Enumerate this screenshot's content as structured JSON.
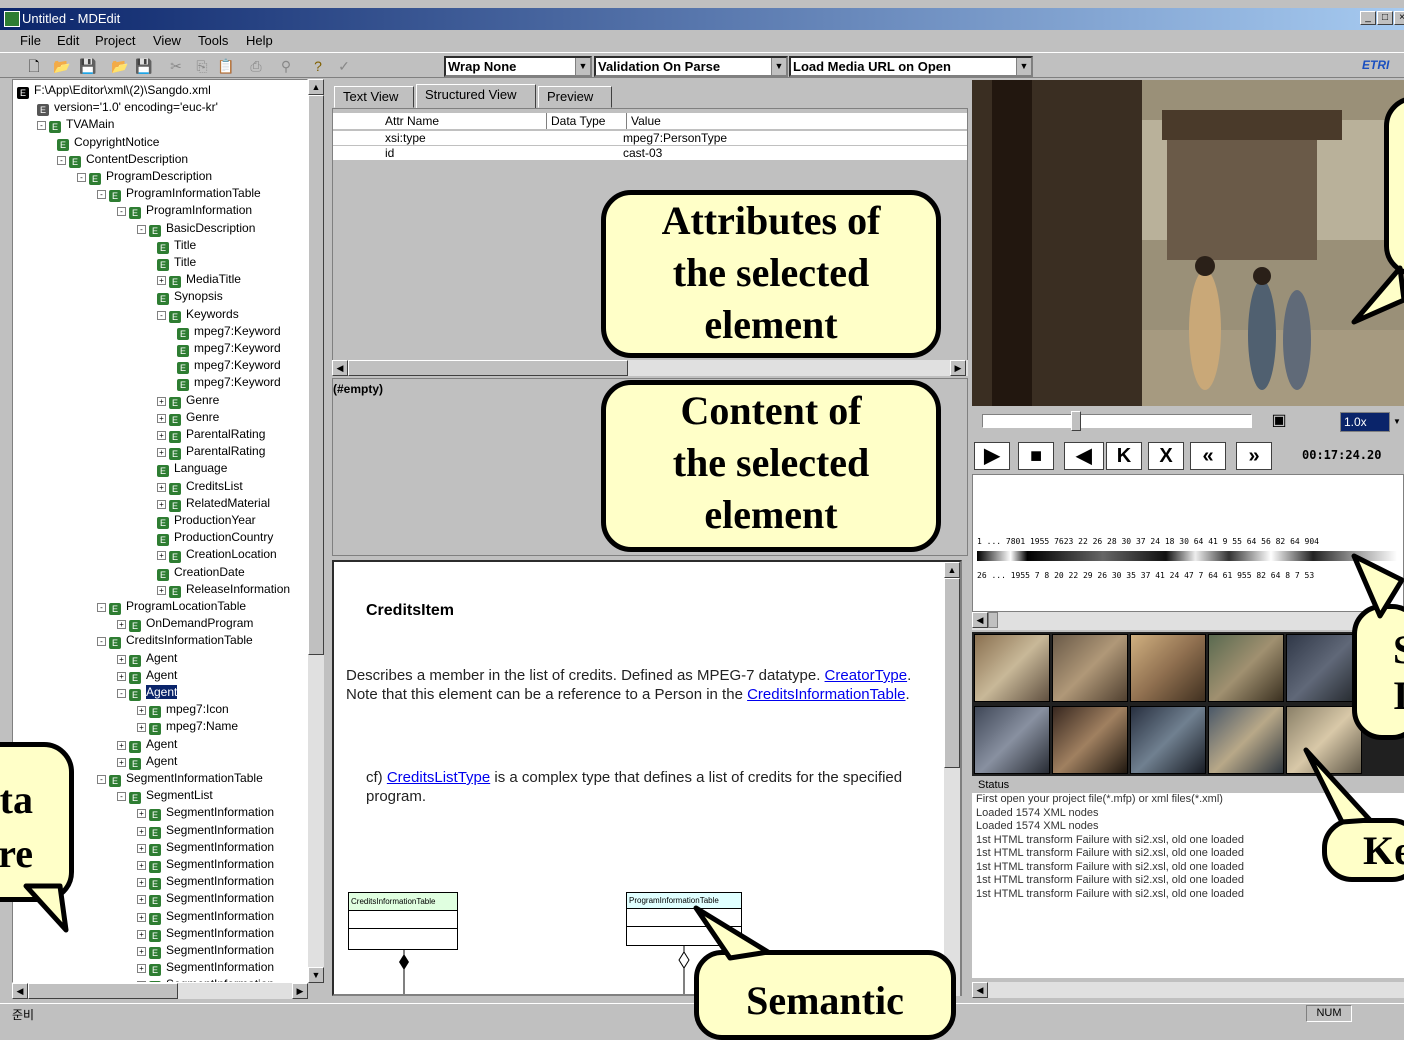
{
  "window": {
    "title": "Untitled - MDEdit"
  },
  "menu": [
    "File",
    "Edit",
    "Project",
    "View",
    "Tools",
    "Help"
  ],
  "toolbar": {
    "wrap": "Wrap None",
    "validation": "Validation On Parse",
    "media": "Load Media URL on Open",
    "logo": "ETRI"
  },
  "tree": {
    "nodes": [
      {
        "label": "F:\\App\\Editor\\xml\\(2)\\Sangdo.xml",
        "level": 0,
        "pm": "",
        "selected": false
      },
      {
        "label": "version='1.0' encoding='euc-kr'",
        "level": 1,
        "pm": "",
        "selected": false
      },
      {
        "label": "TVAMain",
        "level": 1,
        "pm": "-",
        "selected": false
      },
      {
        "label": "CopyrightNotice",
        "level": 2,
        "pm": "",
        "selected": false
      },
      {
        "label": "ContentDescription",
        "level": 2,
        "pm": "-",
        "selected": false
      },
      {
        "label": "ProgramDescription",
        "level": 3,
        "pm": "-",
        "selected": false
      },
      {
        "label": "ProgramInformationTable",
        "level": 4,
        "pm": "-",
        "selected": false
      },
      {
        "label": "ProgramInformation",
        "level": 5,
        "pm": "-",
        "selected": false
      },
      {
        "label": "BasicDescription",
        "level": 6,
        "pm": "-",
        "selected": false
      },
      {
        "label": "Title",
        "level": 7,
        "pm": "",
        "selected": false
      },
      {
        "label": "Title",
        "level": 7,
        "pm": "",
        "selected": false
      },
      {
        "label": "MediaTitle",
        "level": 7,
        "pm": "+",
        "selected": false
      },
      {
        "label": "Synopsis",
        "level": 7,
        "pm": "",
        "selected": false
      },
      {
        "label": "Keywords",
        "level": 7,
        "pm": "-",
        "selected": false
      },
      {
        "label": "mpeg7:Keyword",
        "level": 8,
        "pm": "",
        "selected": false
      },
      {
        "label": "mpeg7:Keyword",
        "level": 8,
        "pm": "",
        "selected": false
      },
      {
        "label": "mpeg7:Keyword",
        "level": 8,
        "pm": "",
        "selected": false
      },
      {
        "label": "mpeg7:Keyword",
        "level": 8,
        "pm": "",
        "selected": false
      },
      {
        "label": "Genre",
        "level": 7,
        "pm": "+",
        "selected": false
      },
      {
        "label": "Genre",
        "level": 7,
        "pm": "+",
        "selected": false
      },
      {
        "label": "ParentalRating",
        "level": 7,
        "pm": "+",
        "selected": false
      },
      {
        "label": "ParentalRating",
        "level": 7,
        "pm": "+",
        "selected": false
      },
      {
        "label": "Language",
        "level": 7,
        "pm": "",
        "selected": false
      },
      {
        "label": "CreditsList",
        "level": 7,
        "pm": "+",
        "selected": false
      },
      {
        "label": "RelatedMaterial",
        "level": 7,
        "pm": "+",
        "selected": false
      },
      {
        "label": "ProductionYear",
        "level": 7,
        "pm": "",
        "selected": false
      },
      {
        "label": "ProductionCountry",
        "level": 7,
        "pm": "",
        "selected": false
      },
      {
        "label": "CreationLocation",
        "level": 7,
        "pm": "+",
        "selected": false
      },
      {
        "label": "CreationDate",
        "level": 7,
        "pm": "",
        "selected": false
      },
      {
        "label": "ReleaseInformation",
        "level": 7,
        "pm": "+",
        "selected": false
      },
      {
        "label": "ProgramLocationTable",
        "level": 4,
        "pm": "-",
        "selected": false
      },
      {
        "label": "OnDemandProgram",
        "level": 5,
        "pm": "+",
        "selected": false
      },
      {
        "label": "CreditsInformationTable",
        "level": 4,
        "pm": "-",
        "selected": false
      },
      {
        "label": "Agent",
        "level": 5,
        "pm": "+",
        "selected": false
      },
      {
        "label": "Agent",
        "level": 5,
        "pm": "+",
        "selected": false
      },
      {
        "label": "Agent",
        "level": 5,
        "pm": "-",
        "selected": true
      },
      {
        "label": "mpeg7:Icon",
        "level": 6,
        "pm": "+",
        "selected": false
      },
      {
        "label": "mpeg7:Name",
        "level": 6,
        "pm": "+",
        "selected": false
      },
      {
        "label": "Agent",
        "level": 5,
        "pm": "+",
        "selected": false
      },
      {
        "label": "Agent",
        "level": 5,
        "pm": "+",
        "selected": false
      },
      {
        "label": "SegmentInformationTable",
        "level": 4,
        "pm": "-",
        "selected": false
      },
      {
        "label": "SegmentList",
        "level": 5,
        "pm": "-",
        "selected": false
      },
      {
        "label": "SegmentInformation",
        "level": 6,
        "pm": "+",
        "selected": false
      },
      {
        "label": "SegmentInformation",
        "level": 6,
        "pm": "+",
        "selected": false
      },
      {
        "label": "SegmentInformation",
        "level": 6,
        "pm": "+",
        "selected": false
      },
      {
        "label": "SegmentInformation",
        "level": 6,
        "pm": "+",
        "selected": false
      },
      {
        "label": "SegmentInformation",
        "level": 6,
        "pm": "+",
        "selected": false
      },
      {
        "label": "SegmentInformation",
        "level": 6,
        "pm": "+",
        "selected": false
      },
      {
        "label": "SegmentInformation",
        "level": 6,
        "pm": "+",
        "selected": false
      },
      {
        "label": "SegmentInformation",
        "level": 6,
        "pm": "+",
        "selected": false
      },
      {
        "label": "SegmentInformation",
        "level": 6,
        "pm": "+",
        "selected": false
      },
      {
        "label": "SegmentInformation",
        "level": 6,
        "pm": "+",
        "selected": false
      },
      {
        "label": "SegmentInformation",
        "level": 6,
        "pm": "+",
        "selected": false
      }
    ]
  },
  "tabs": [
    "Text View",
    "Structured View",
    "Preview"
  ],
  "attributes": {
    "headers": [
      "Attr Name",
      "Data Type",
      "Value"
    ],
    "rows": [
      {
        "name": "xsi:type",
        "type": "",
        "value": "mpeg7:PersonType"
      },
      {
        "name": "id",
        "type": "",
        "value": "cast-03"
      }
    ]
  },
  "content": {
    "text": "(#empty)"
  },
  "doc": {
    "heading": "CreditsItem",
    "p1_pre": "Describes a member in the list of credits. Defined as MPEG-7 datatype.",
    "p1_link1": "CreatorType",
    "p1_mid": ". Note that this element can be a reference to a Person in the",
    "p1_link2": "CreditsInformationTable",
    "p1_end": ".",
    "p2_pre": "cf) ",
    "p2_link": "CreditsListType",
    "p2_post": " is a complex type that defines a list of credits for the specified program.",
    "diagram_left": "CreditsInformationTable",
    "diagram_right": "ProgramInformationTable"
  },
  "player": {
    "speed": "1.0x",
    "time": "00:17:24.20",
    "timeline_a": "1 ... 7801 1955 7623 22 26 28 30 37 24 18 30 64 41 9 55 64 56 82 64 904",
    "timeline_b": "26 ... 1955 7 8 20 22 29 26 30 35 37 41 24 47 7 64 61 955 82 64 8 7 53"
  },
  "status": {
    "title": "Status",
    "lines": [
      "First open your project file(*.mfp) or xml files(*.xml)",
      "Loaded 1574 XML nodes",
      "Loaded 1574 XML nodes",
      "1st HTML transform Failure with si2.xsl, old one loaded",
      "1st HTML transform Failure with si2.xsl, old one loaded",
      "1st HTML transform Failure with si2.xsl, old one loaded",
      "1st HTML transform Failure with si2.xsl, old one loaded",
      "1st HTML transform Failure with si2.xsl, old one loaded"
    ]
  },
  "statusbar": {
    "left": "준비",
    "num": "NUM"
  },
  "callouts": {
    "attributes": [
      "Attributes of",
      "the selected",
      "element"
    ],
    "content": [
      "Content of",
      "the selected",
      "element"
    ],
    "semantic": "Semantic",
    "data_left": [
      "ta",
      "re"
    ],
    "right_s": [
      "S",
      "I"
    ],
    "right_k": "Ke"
  }
}
